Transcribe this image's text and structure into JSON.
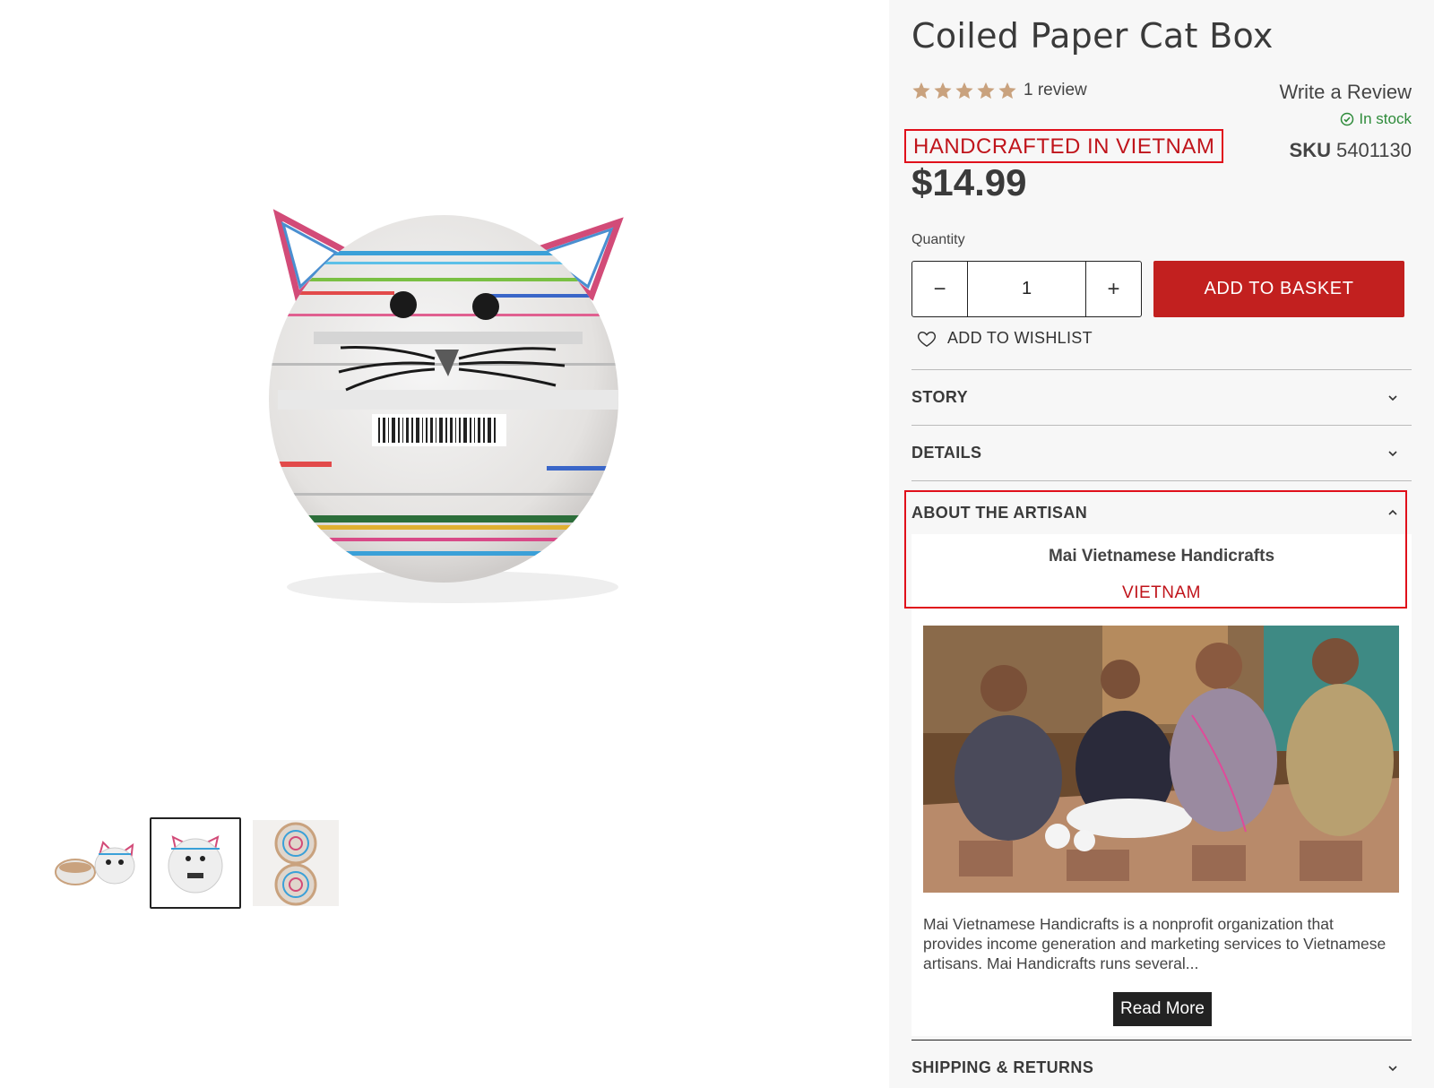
{
  "product": {
    "title": "Coiled Paper Cat Box",
    "rating_stars": 5,
    "review_count_label": "1 review",
    "write_review_label": "Write a Review",
    "stock_label": "In stock",
    "origin_label": "HANDCRAFTED IN VIETNAM",
    "sku_label": "SKU",
    "sku_value": "5401130",
    "price": "$14.99"
  },
  "purchase": {
    "quantity_label": "Quantity",
    "quantity_value": "1",
    "minus_label": "−",
    "plus_label": "+",
    "add_to_basket_label": "ADD TO BASKET",
    "wishlist_label": "ADD TO WISHLIST"
  },
  "accordion": {
    "story_label": "STORY",
    "details_label": "DETAILS",
    "artisan_label": "ABOUT THE ARTISAN",
    "shipping_label": "SHIPPING & RETURNS"
  },
  "artisan": {
    "name": "Mai Vietnamese Handicrafts",
    "country": "VIETNAM",
    "description": "Mai Vietnamese Handicrafts is a nonprofit organization that provides income generation and marketing services to Vietnamese artisans. Mai Handicrafts runs several...",
    "read_more_label": "Read More"
  },
  "colors": {
    "accent_red": "#c2201f",
    "highlight_border": "#e0101b",
    "star": "#c9a27e",
    "stock_green": "#2e8b3a"
  },
  "icons": [
    "star-icon",
    "check-circle-icon",
    "heart-icon",
    "chevron-down-icon",
    "chevron-up-icon"
  ]
}
